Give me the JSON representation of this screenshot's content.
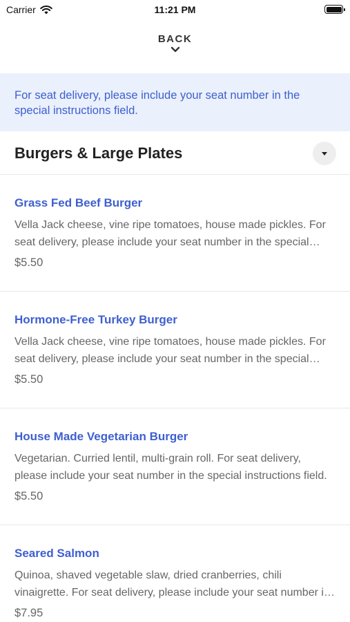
{
  "status_bar": {
    "carrier": "Carrier",
    "time": "11:21 PM"
  },
  "nav": {
    "back_label": "BACK"
  },
  "notice": {
    "text": "For seat delivery, please include your seat number in the special instructions field."
  },
  "section": {
    "title": "Burgers & Large Plates"
  },
  "menu_items": [
    {
      "name": "Grass Fed Beef Burger",
      "description": "Vella Jack cheese, vine ripe tomatoes, house made pickles. For seat delivery, please include your seat number in the special instructions field.",
      "price": "$5.50"
    },
    {
      "name": "Hormone-Free Turkey Burger",
      "description": "Vella Jack cheese, vine ripe tomatoes, house made pickles. For seat delivery, please include your seat number in the special instructions field.",
      "price": "$5.50"
    },
    {
      "name": "House Made Vegetarian Burger",
      "description": "Vegetarian. Curried lentil, multi-grain roll. For seat delivery, please include your seat number in the special instructions field.",
      "price": "$5.50"
    },
    {
      "name": "Seared Salmon",
      "description": "Quinoa, shaved vegetable slaw, dried cranberries, chili vinaigrette. For seat delivery, please include your seat number in the special instructions field.",
      "price": "$7.95"
    }
  ],
  "colors": {
    "accent": "#3e5fcf",
    "notice_bg": "#eaf0fc",
    "muted_text": "#666666"
  },
  "icons": [
    "wifi-icon",
    "battery-icon",
    "chevron-down-icon",
    "caret-down-icon"
  ]
}
